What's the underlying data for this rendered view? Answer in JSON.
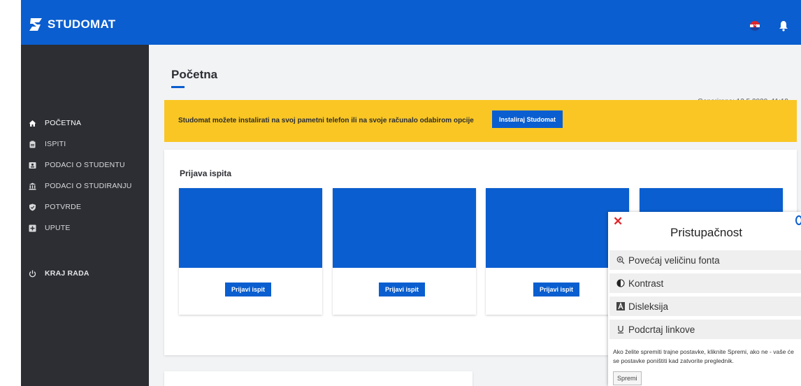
{
  "header": {
    "app_name": "STUDOMAT"
  },
  "sidebar": {
    "items": [
      {
        "label": "POČETNA",
        "icon": "home-icon"
      },
      {
        "label": "ISPITI",
        "icon": "clipboard-icon"
      },
      {
        "label": "PODACI O STUDENTU",
        "icon": "id-card-icon"
      },
      {
        "label": "PODACI O STUDIRANJU",
        "icon": "institution-icon"
      },
      {
        "label": "POTVRDE",
        "icon": "shield-icon"
      },
      {
        "label": "UPUTE",
        "icon": "plus-square-icon"
      }
    ],
    "logout": {
      "label": "KRAJ RADA",
      "icon": "power-icon"
    }
  },
  "page": {
    "title": "Početna",
    "generated": "Generirano: 13.5.2020. 11:19"
  },
  "banner": {
    "text": "Studomat možete instalirati na svoj pametni telefon ili na svoje računalo odabirom opcije",
    "button": "Instaliraj Studomat"
  },
  "exams": {
    "title": "Prijava ispita",
    "tiles": [
      {
        "button": "Prijavi ispit"
      },
      {
        "button": "Prijavi ispit"
      },
      {
        "button": "Prijavi ispit"
      }
    ]
  },
  "accessibility": {
    "title": "Pristupačnost",
    "options": [
      {
        "label": "Povećaj veličinu fonta",
        "icon": "zoom-in-icon"
      },
      {
        "label": "Kontrast",
        "icon": "contrast-icon"
      },
      {
        "label": "Disleksija",
        "icon": "dyslexia-icon"
      },
      {
        "label": "Podcrtaj linkove",
        "icon": "underline-icon"
      }
    ],
    "note": "Ako želite spremiti trajne postavke, kliknite Spremi, ako ne - vaše će se postavke poništiti kad zatvorite preglednik.",
    "save": "Spremi"
  },
  "colors": {
    "primary": "#0a5ecf",
    "sidebar": "#2c2e33",
    "banner": "#f9c624",
    "close": "#e0262b"
  }
}
